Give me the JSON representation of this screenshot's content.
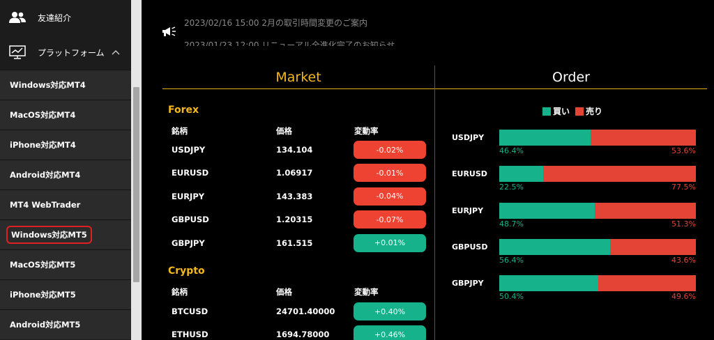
{
  "sidebar": {
    "friend": {
      "label": "友達紹介",
      "icon": "users-icon"
    },
    "platform": {
      "label": "プラットフォーム",
      "icon": "monitor-chart-icon",
      "chevron": "^"
    },
    "items": [
      {
        "label": "Windows対応MT4"
      },
      {
        "label": "MacOS対応MT4"
      },
      {
        "label": "iPhone対応MT4"
      },
      {
        "label": "Android対応MT4"
      },
      {
        "label": "MT4 WebTrader"
      },
      {
        "label": "Windows対応MT5",
        "highlighted": true
      },
      {
        "label": "MacOS対応MT5"
      },
      {
        "label": "iPhone対応MT5"
      },
      {
        "label": "Android対応MT5"
      }
    ]
  },
  "news": {
    "icon": "megaphone-icon",
    "line1": "2023/02/16 15:00  2月の取引時間変更のご案内",
    "line2": "2023/01/23 12:00  リニューアル全進化完了のお知らせ"
  },
  "market": {
    "title": "Market",
    "forex": {
      "title": "Forex",
      "headers": {
        "symbol": "銘柄",
        "price": "価格",
        "change": "変動率"
      },
      "rows": [
        {
          "symbol": "USDJPY",
          "price": "134.104",
          "change": "-0.02%",
          "dir": "neg"
        },
        {
          "symbol": "EURUSD",
          "price": "1.06917",
          "change": "-0.01%",
          "dir": "neg"
        },
        {
          "symbol": "EURJPY",
          "price": "143.383",
          "change": "-0.04%",
          "dir": "neg"
        },
        {
          "symbol": "GBPUSD",
          "price": "1.20315",
          "change": "-0.07%",
          "dir": "neg"
        },
        {
          "symbol": "GBPJPY",
          "price": "161.515",
          "change": "+0.01%",
          "dir": "pos"
        }
      ]
    },
    "crypto": {
      "title": "Crypto",
      "headers": {
        "symbol": "銘柄",
        "price": "価格",
        "change": "変動率"
      },
      "rows": [
        {
          "symbol": "BTCUSD",
          "price": "24701.40000",
          "change": "+0.40%",
          "dir": "pos"
        },
        {
          "symbol": "ETHUSD",
          "price": "1694.78000",
          "change": "+0.46%",
          "dir": "pos"
        }
      ]
    }
  },
  "order": {
    "title": "Order",
    "legend": {
      "buy": "買い",
      "sell": "売り"
    },
    "colors": {
      "buy": "#16b28b",
      "sell": "#e34435"
    },
    "rows": [
      {
        "symbol": "USDJPY",
        "buy": 46.4,
        "sell": 53.6,
        "buy_label": "46.4%",
        "sell_label": "53.6%"
      },
      {
        "symbol": "EURUSD",
        "buy": 22.5,
        "sell": 77.5,
        "buy_label": "22.5%",
        "sell_label": "77.5%"
      },
      {
        "symbol": "EURJPY",
        "buy": 48.7,
        "sell": 51.3,
        "buy_label": "48.7%",
        "sell_label": "51.3%"
      },
      {
        "symbol": "GBPUSD",
        "buy": 56.4,
        "sell": 43.6,
        "buy_label": "56.4%",
        "sell_label": "43.6%"
      },
      {
        "symbol": "GBPJPY",
        "buy": 50.4,
        "sell": 49.6,
        "buy_label": "50.4%",
        "sell_label": "49.6%"
      }
    ]
  }
}
